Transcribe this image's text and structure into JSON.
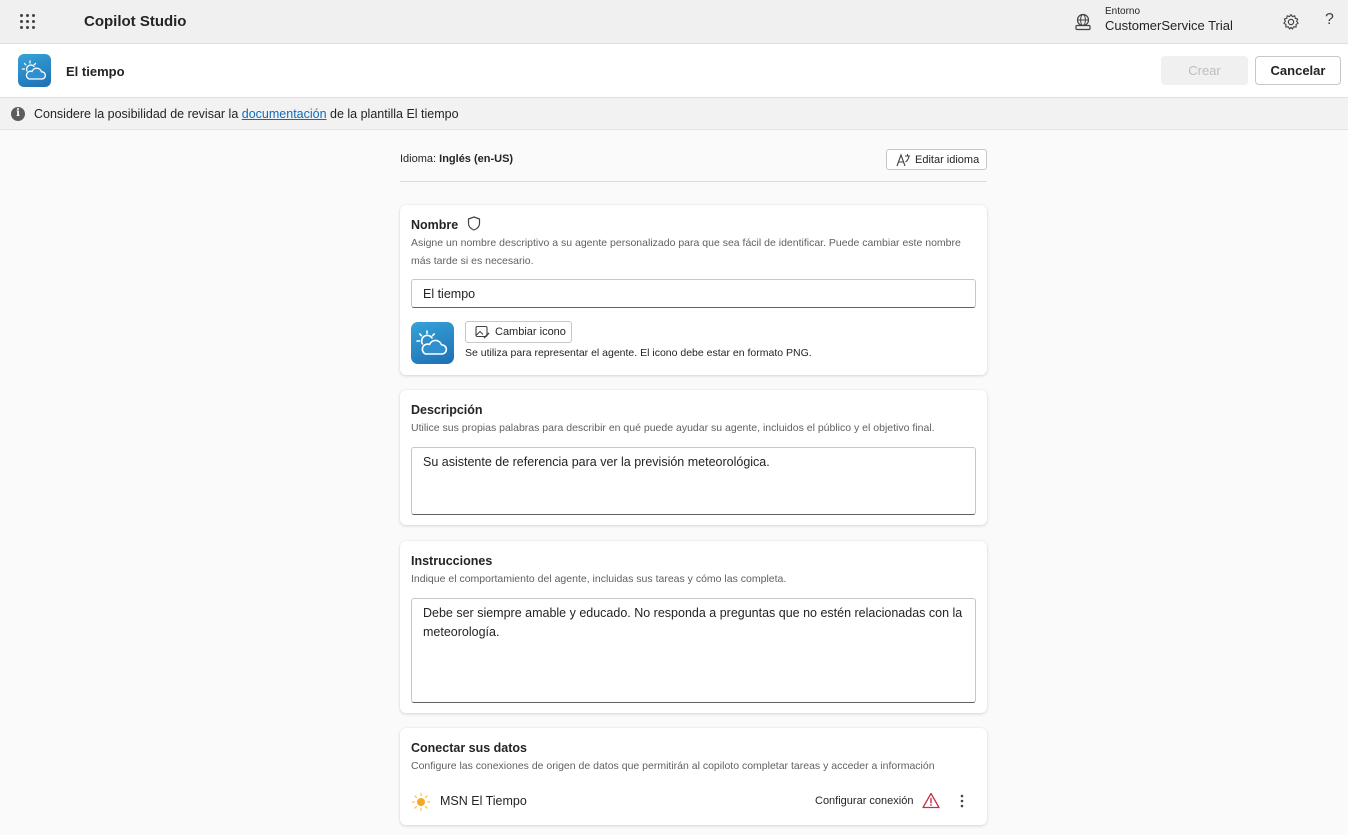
{
  "appbar": {
    "app_title": "Copilot Studio",
    "environment_label": "Entorno",
    "environment_name": "CustomerService Trial",
    "help_glyph": "?",
    "icons": [
      "waffle-icon",
      "environment-icon",
      "gear-icon",
      "help-icon"
    ]
  },
  "agent": {
    "title": "El tiempo",
    "create_label": "Crear",
    "cancel_label": "Cancelar"
  },
  "infobar": {
    "prefix": "Considere la posibilidad de revisar la ",
    "link": "documentación",
    "suffix": " de la plantilla El tiempo",
    "info_glyph": "i"
  },
  "language": {
    "label": "Idioma: ",
    "value": "Inglés (en-US)",
    "edit_label": "Editar idioma"
  },
  "name_card": {
    "title": "Nombre",
    "description": "Asigne un nombre descriptivo a su agente personalizado para que sea fácil de identificar. Puede cambiar este nombre más tarde si es necesario.",
    "value": "El tiempo",
    "change_icon_label": "Cambiar icono",
    "icon_note": "Se utiliza para representar el agente. El icono debe estar en formato PNG."
  },
  "description_card": {
    "title": "Descripción",
    "description": "Utilice sus propias palabras para describir en qué puede ayudar su agente, incluidos el público y el objetivo final.",
    "value": "Su asistente de referencia para ver la previsión meteorológica."
  },
  "instructions_card": {
    "title": "Instrucciones",
    "description": "Indique el comportamiento del agente, incluidas sus tareas y cómo las completa.",
    "value": "Debe ser siempre amable y educado. No responda a preguntas que no estén relacionadas con la meteorología."
  },
  "data_card": {
    "title": "Conectar sus datos",
    "description": "Configure las conexiones de origen de datos que permitirán al copiloto completar tareas y acceder a información",
    "sources": [
      {
        "name": "MSN El Tiempo",
        "action": "Configurar conexión",
        "status": "warning"
      }
    ]
  },
  "colors": {
    "accent": "#0f6cbd",
    "warning": "#c4314b",
    "sun": "#f7a823",
    "agent_icon": "#2b8fd0"
  }
}
